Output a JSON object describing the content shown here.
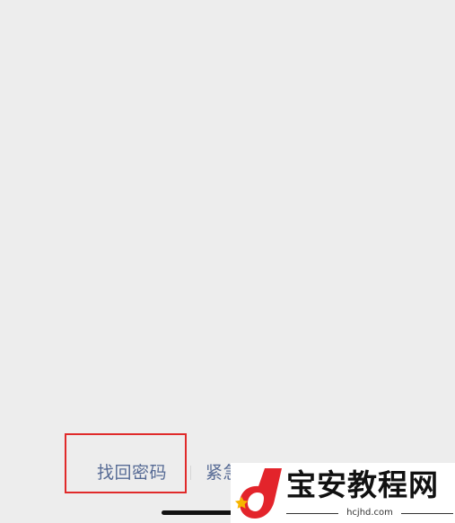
{
  "bottom_links": {
    "find_password": "找回密码",
    "emergency": "紧急"
  },
  "watermark": {
    "title": "宝安教程网",
    "url": "hcjhd.com"
  },
  "colors": {
    "background": "#ededed",
    "link": "#576b95",
    "highlight": "#e02a2a",
    "logo_red": "#e3242b",
    "logo_star": "#f7b500"
  }
}
